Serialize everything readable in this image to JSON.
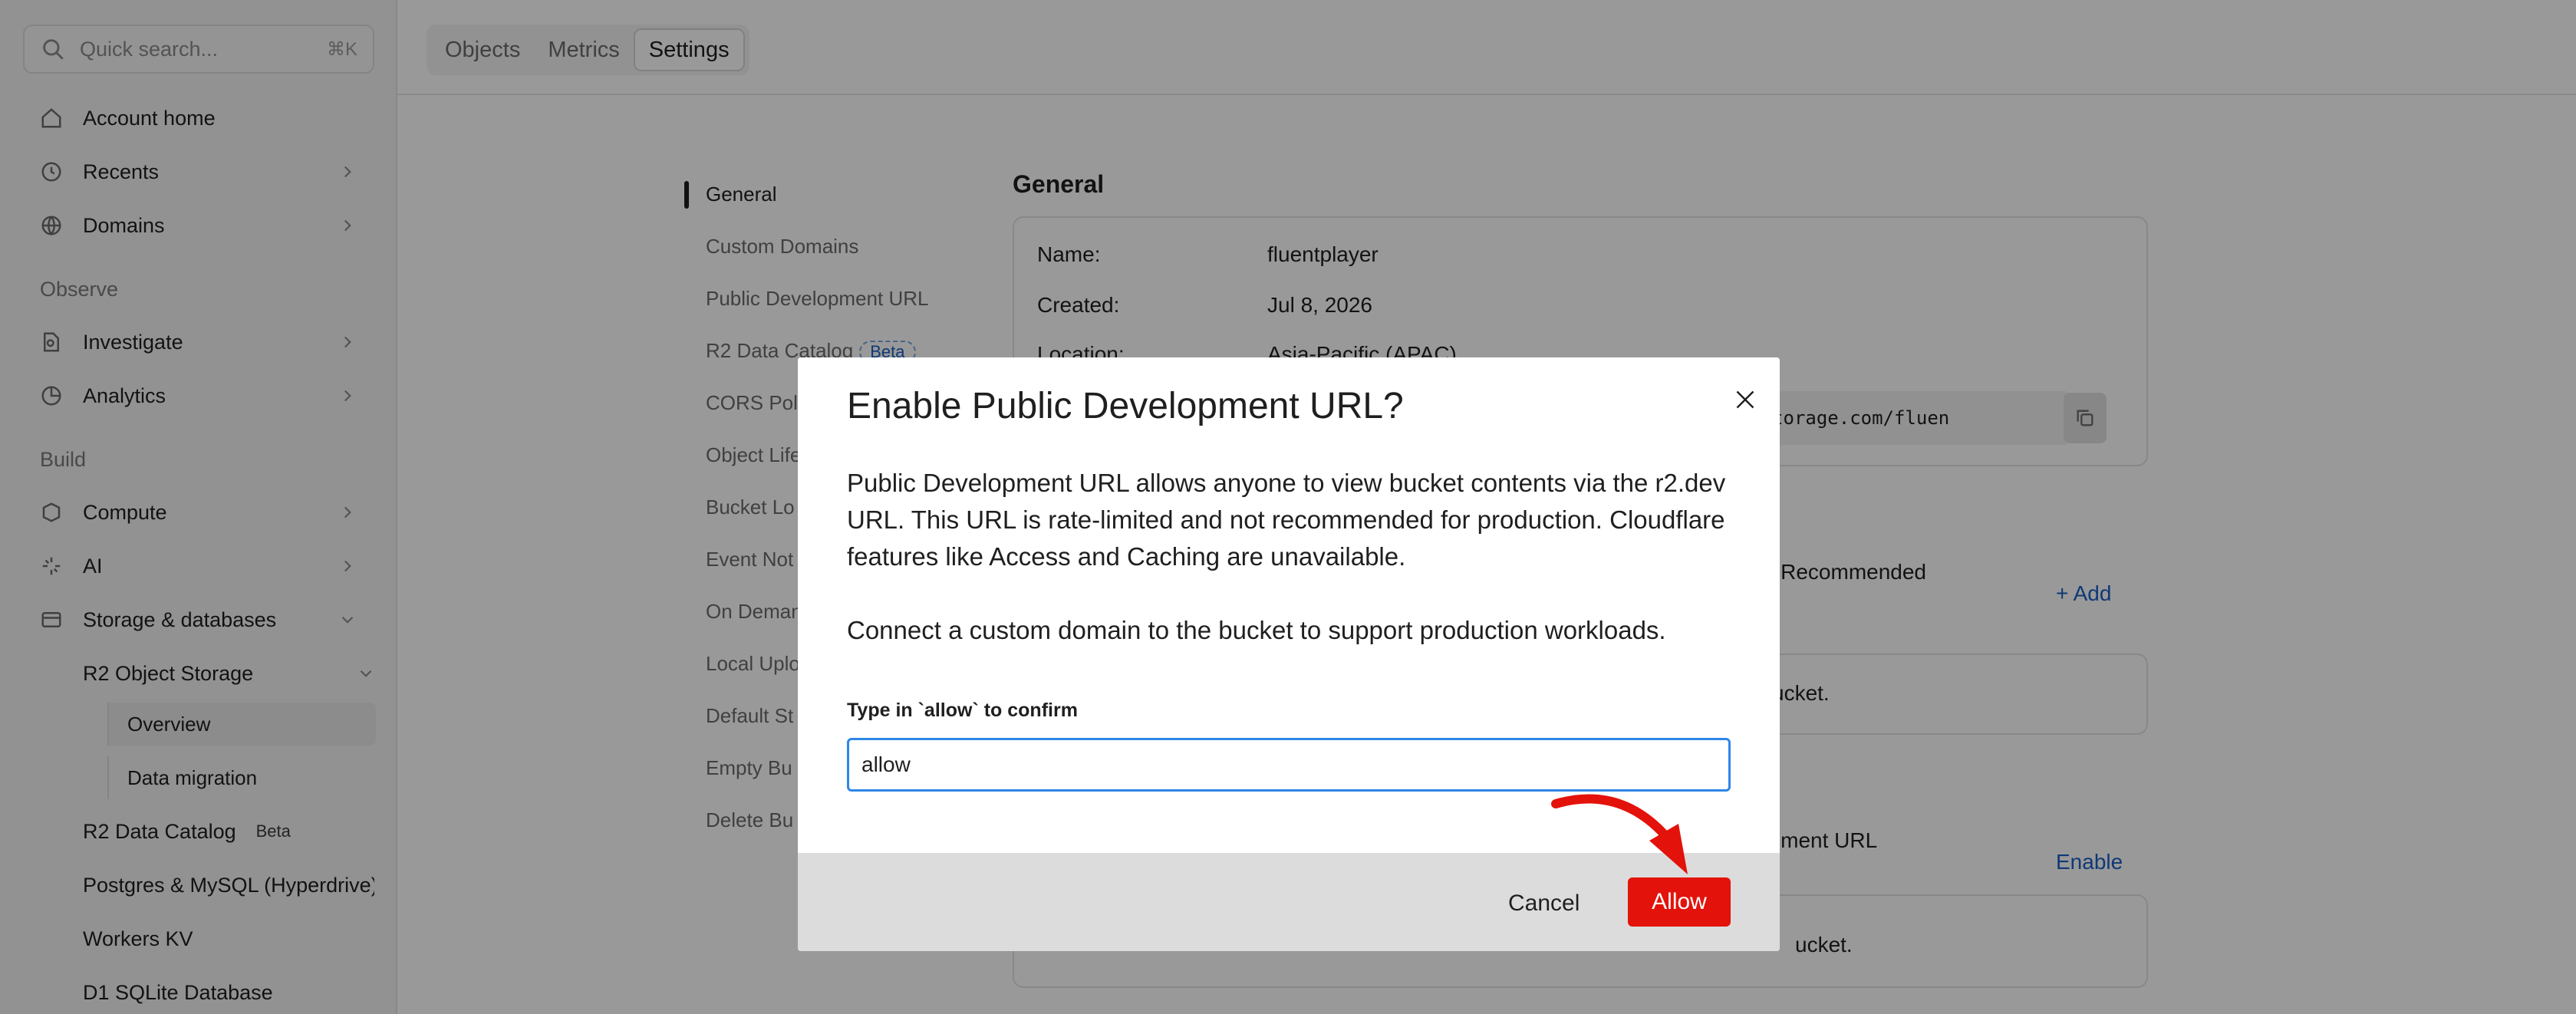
{
  "sidebar": {
    "search_placeholder": "Quick search...",
    "search_shortcut": "⌘K",
    "items": [
      {
        "label": "Account home",
        "icon": "home-icon"
      },
      {
        "label": "Recents",
        "icon": "clock-icon"
      },
      {
        "label": "Domains",
        "icon": "globe-icon"
      }
    ],
    "section_observe": "Observe",
    "observe_items": [
      {
        "label": "Investigate",
        "icon": "document-search-icon"
      },
      {
        "label": "Analytics",
        "icon": "chart-icon"
      }
    ],
    "section_build": "Build",
    "build_items": [
      {
        "label": "Compute",
        "icon": "compute-icon"
      },
      {
        "label": "AI",
        "icon": "sparkle-icon"
      },
      {
        "label": "Storage & databases",
        "icon": "database-icon"
      }
    ],
    "storage_sub": {
      "r2_object_storage": "R2 Object Storage",
      "overview": "Overview",
      "data_migration": "Data migration",
      "r2_data_catalog": "R2 Data Catalog",
      "r2_data_catalog_badge": "Beta",
      "postgres": "Postgres & MySQL (Hyperdrive)",
      "workers_kv": "Workers KV",
      "d1": "D1 SQLite Database"
    }
  },
  "tabs": [
    "Objects",
    "Metrics",
    "Settings"
  ],
  "active_tab": "Settings",
  "settings_nav": {
    "general": "General",
    "custom_domains": "Custom Domains",
    "public_dev_url": "Public Development URL",
    "r2_data_catalog": "R2 Data Catalog",
    "r2_data_catalog_badge": "Beta",
    "cors": "CORS Poli",
    "object_life": "Object Life",
    "bucket_lock": "Bucket Lo",
    "event_notif": "Event Not",
    "on_demand": "On Deman",
    "local_uploads": "Local Uplo",
    "default_storage": "Default St",
    "empty_bucket": "Empty Bu",
    "delete_bucket": "Delete Bu"
  },
  "general": {
    "heading": "General",
    "name_label": "Name:",
    "name_value": "fluentplayer",
    "created_label": "Created:",
    "created_value": "Jul 8, 2026",
    "location_label": "Location:",
    "location_value": "Asia-Pacific (APAC)",
    "s3_api_value": "oudflarestorage.com/fluen"
  },
  "background_text": {
    "custom_domain_desc": "n. Recommended",
    "add_label": "Add",
    "no_domains": "ucket.",
    "dev_url_desc": "opment URL",
    "enable_label": "Enable",
    "dev_url_status": "ucket."
  },
  "modal": {
    "title": "Enable Public Development URL?",
    "paragraph1": "Public Development URL allows anyone to view bucket contents via the r2.dev URL. This URL is rate-limited and not recommended for production. Cloudflare features like Access and Caching are unavailable.",
    "paragraph2": "Connect a custom domain to the bucket to support production workloads.",
    "confirm_label": "Type in `allow` to confirm",
    "input_value": "allow",
    "cancel_label": "Cancel",
    "allow_label": "Allow"
  },
  "colors": {
    "accent_blue": "#2f86e6",
    "danger_red": "#e3120b",
    "annotation_arrow": "#e3120b"
  }
}
